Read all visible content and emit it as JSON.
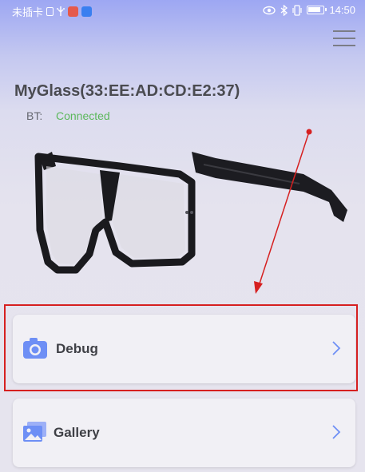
{
  "status_bar": {
    "carrier": "未插卡",
    "time": "14:50"
  },
  "header": {
    "menu_icon": "hamburger-menu-icon"
  },
  "device": {
    "name": "MyGlass(33:EE:AD:CD:E2:37)",
    "bt_label": "BT:",
    "bt_status": "Connected",
    "bt_status_color": "#5cb85c"
  },
  "menu_items": [
    {
      "label": "Debug",
      "icon": "camera-icon",
      "icon_color": "#6e8ff5"
    },
    {
      "label": "Gallery",
      "icon": "gallery-icon",
      "icon_color": "#6e8ff5"
    }
  ],
  "annotation": {
    "color": "#d62020"
  }
}
